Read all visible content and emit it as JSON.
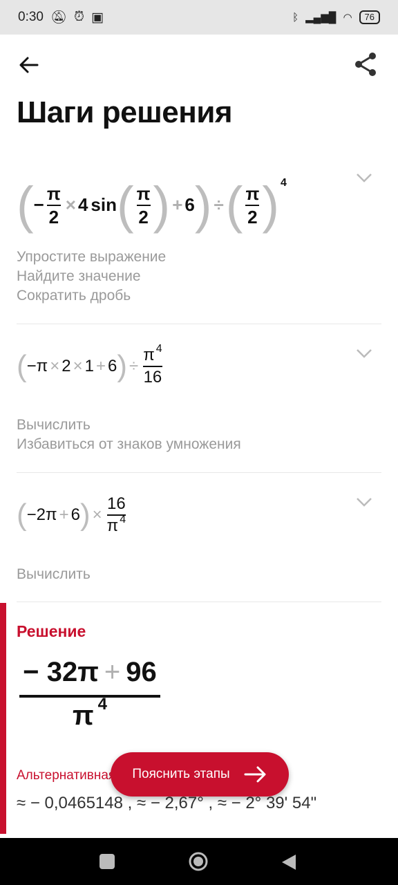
{
  "status_bar": {
    "time": "0:30",
    "battery": "76"
  },
  "app_bar": {
    "back_icon": "arrow-left-icon",
    "share_icon": "share-icon"
  },
  "page_title": "Шаги решения",
  "steps": [
    {
      "descriptions": [
        "Упростите выражение",
        "Найдите значение",
        "Сократить дробь"
      ]
    },
    {
      "descriptions": [
        "Вычислить",
        "Избавиться от знаков умножения"
      ]
    },
    {
      "descriptions": [
        "Вычислить"
      ]
    }
  ],
  "math": {
    "pi": "π",
    "two": "2",
    "four": "4",
    "six": "6",
    "one": "1",
    "sixteen": "16",
    "minus": "−",
    "times": "×",
    "plus": "+",
    "divide": "÷",
    "sin": "sin",
    "neg2pi": "−2π",
    "minus_pi": "−π"
  },
  "solution": {
    "label": "Решение",
    "numerator_part1": "− 32π",
    "numerator_plus": "+",
    "numerator_part2": "96",
    "denominator": "π",
    "denominator_exp": "4",
    "alternative_label": "Альтернативная форма",
    "alternative_values": "≈ − 0,0465148 , ≈ − 2,67° , ≈ − 2° 39' 54\""
  },
  "explain_button": {
    "label": "Пояснить этапы"
  },
  "colors": {
    "accent": "#c8102e",
    "muted_text": "#9a9a9a"
  }
}
